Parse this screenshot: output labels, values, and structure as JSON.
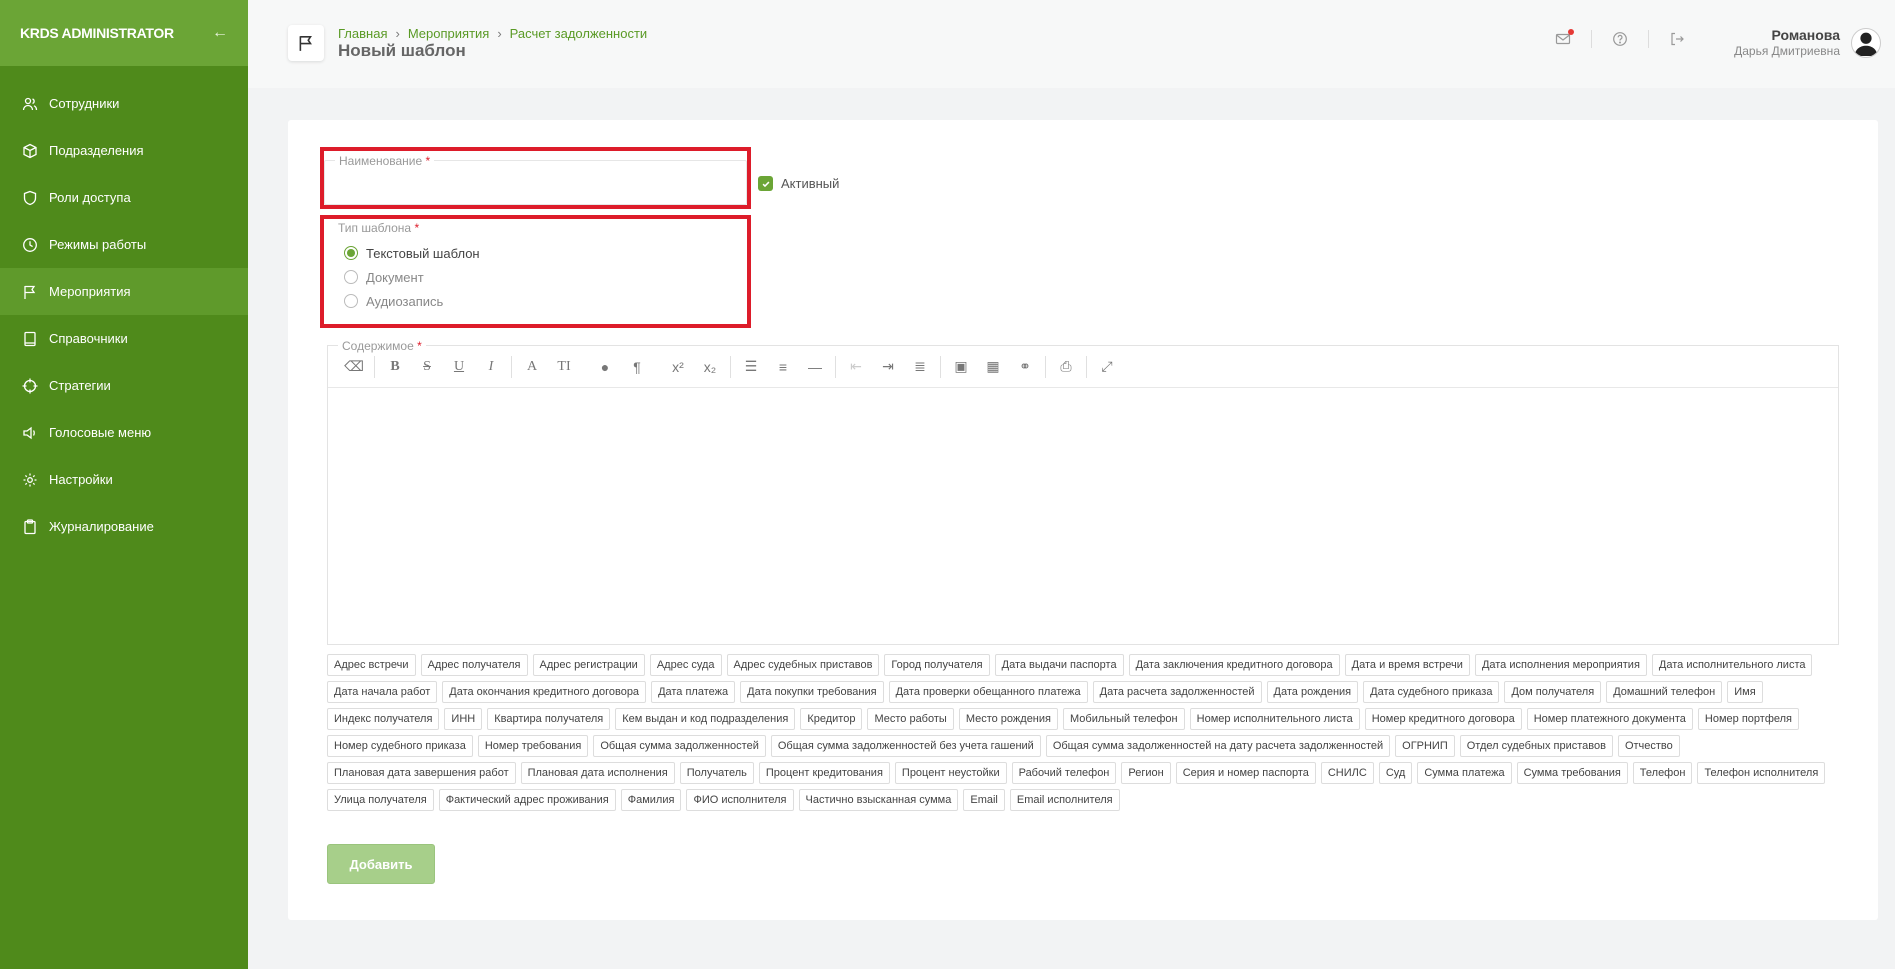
{
  "sidebar": {
    "logo": "KRDS ADMINISTRATOR",
    "collapse_icon": "arrow-left-icon",
    "items": [
      {
        "label": "Сотрудники",
        "icon": "users-icon"
      },
      {
        "label": "Подразделения",
        "icon": "cube-icon"
      },
      {
        "label": "Роли доступа",
        "icon": "shield-icon"
      },
      {
        "label": "Режимы работы",
        "icon": "clock-icon"
      },
      {
        "label": "Мероприятия",
        "icon": "flag-icon"
      },
      {
        "label": "Справочники",
        "icon": "book-icon"
      },
      {
        "label": "Стратегии",
        "icon": "target-icon"
      },
      {
        "label": "Голосовые меню",
        "icon": "speaker-icon"
      },
      {
        "label": "Настройки",
        "icon": "gear-icon"
      },
      {
        "label": "Журналирование",
        "icon": "clipboard-icon"
      }
    ],
    "active_index": 4
  },
  "header": {
    "breadcrumb": [
      "Главная",
      "Мероприятия",
      "Расчет задолженности"
    ],
    "title": "Новый шаблон",
    "user": {
      "last_name": "Романова",
      "first_name": "Дарья Дмитриевна"
    }
  },
  "form": {
    "name_label": "Наименование",
    "required_mark": "*",
    "name_value": "",
    "active_label": "Активный",
    "active_checked": true,
    "type_label": "Тип шаблона",
    "type_options": [
      "Текстовый шаблон",
      "Документ",
      "Аудиозапись"
    ],
    "type_selected": 0,
    "content_label": "Содержимое",
    "content_value": "",
    "add_button": "Добавить"
  },
  "tags_row1": [
    "Адрес встречи",
    "Адрес получателя",
    "Адрес регистрации",
    "Адрес суда",
    "Адрес судебных приставов",
    "Город получателя",
    "Дата выдачи паспорта",
    "Дата заключения кредитного договора",
    "Дата и время встречи",
    "Дата исполнения мероприятия"
  ],
  "tags_row2": [
    "Дата исполнительного листа",
    "Дата начала работ",
    "Дата окончания кредитного договора",
    "Дата платежа",
    "Дата покупки требования",
    "Дата проверки обещанного платежа",
    "Дата расчета задолженностей",
    "Дата рождения",
    "Дата судебного приказа",
    "Дом получателя"
  ],
  "tags_row3": [
    "Домашний телефон",
    "Имя",
    "Индекс получателя",
    "ИНН",
    "Квартира получателя",
    "Кем выдан и код подразделения",
    "Кредитор",
    "Место работы",
    "Место рождения",
    "Мобильный телефон",
    "Номер исполнительного листа",
    "Номер кредитного договора"
  ],
  "tags_row4": [
    "Номер платежного документа",
    "Номер портфеля",
    "Номер судебного приказа",
    "Номер требования",
    "Общая сумма задолженностей",
    "Общая сумма задолженностей без учета гашений",
    "Общая сумма задолженностей на дату расчета задолженностей",
    "ОГРНИП"
  ],
  "tags_row5": [
    "Отдел судебных приставов",
    "Отчество",
    "Плановая дата завершения работ",
    "Плановая дата исполнения",
    "Получатель",
    "Процент кредитования",
    "Процент неустойки",
    "Рабочий телефон",
    "Регион",
    "Серия и номер паспорта",
    "СНИЛС",
    "Суд",
    "Сумма платежа"
  ],
  "tags_row6": [
    "Сумма требования",
    "Телефон",
    "Телефон исполнителя",
    "Улица получателя",
    "Фактический адрес проживания",
    "Фамилия",
    "ФИО исполнителя",
    "Частично взысканная сумма",
    "Email",
    "Email исполнителя"
  ],
  "colors": {
    "sidebar": "#4f8a1b",
    "sidebar_head": "#6ba536",
    "accent": "#6ba536",
    "highlight": "#dd1c2a",
    "button_disabled": "#a7cf8a"
  }
}
